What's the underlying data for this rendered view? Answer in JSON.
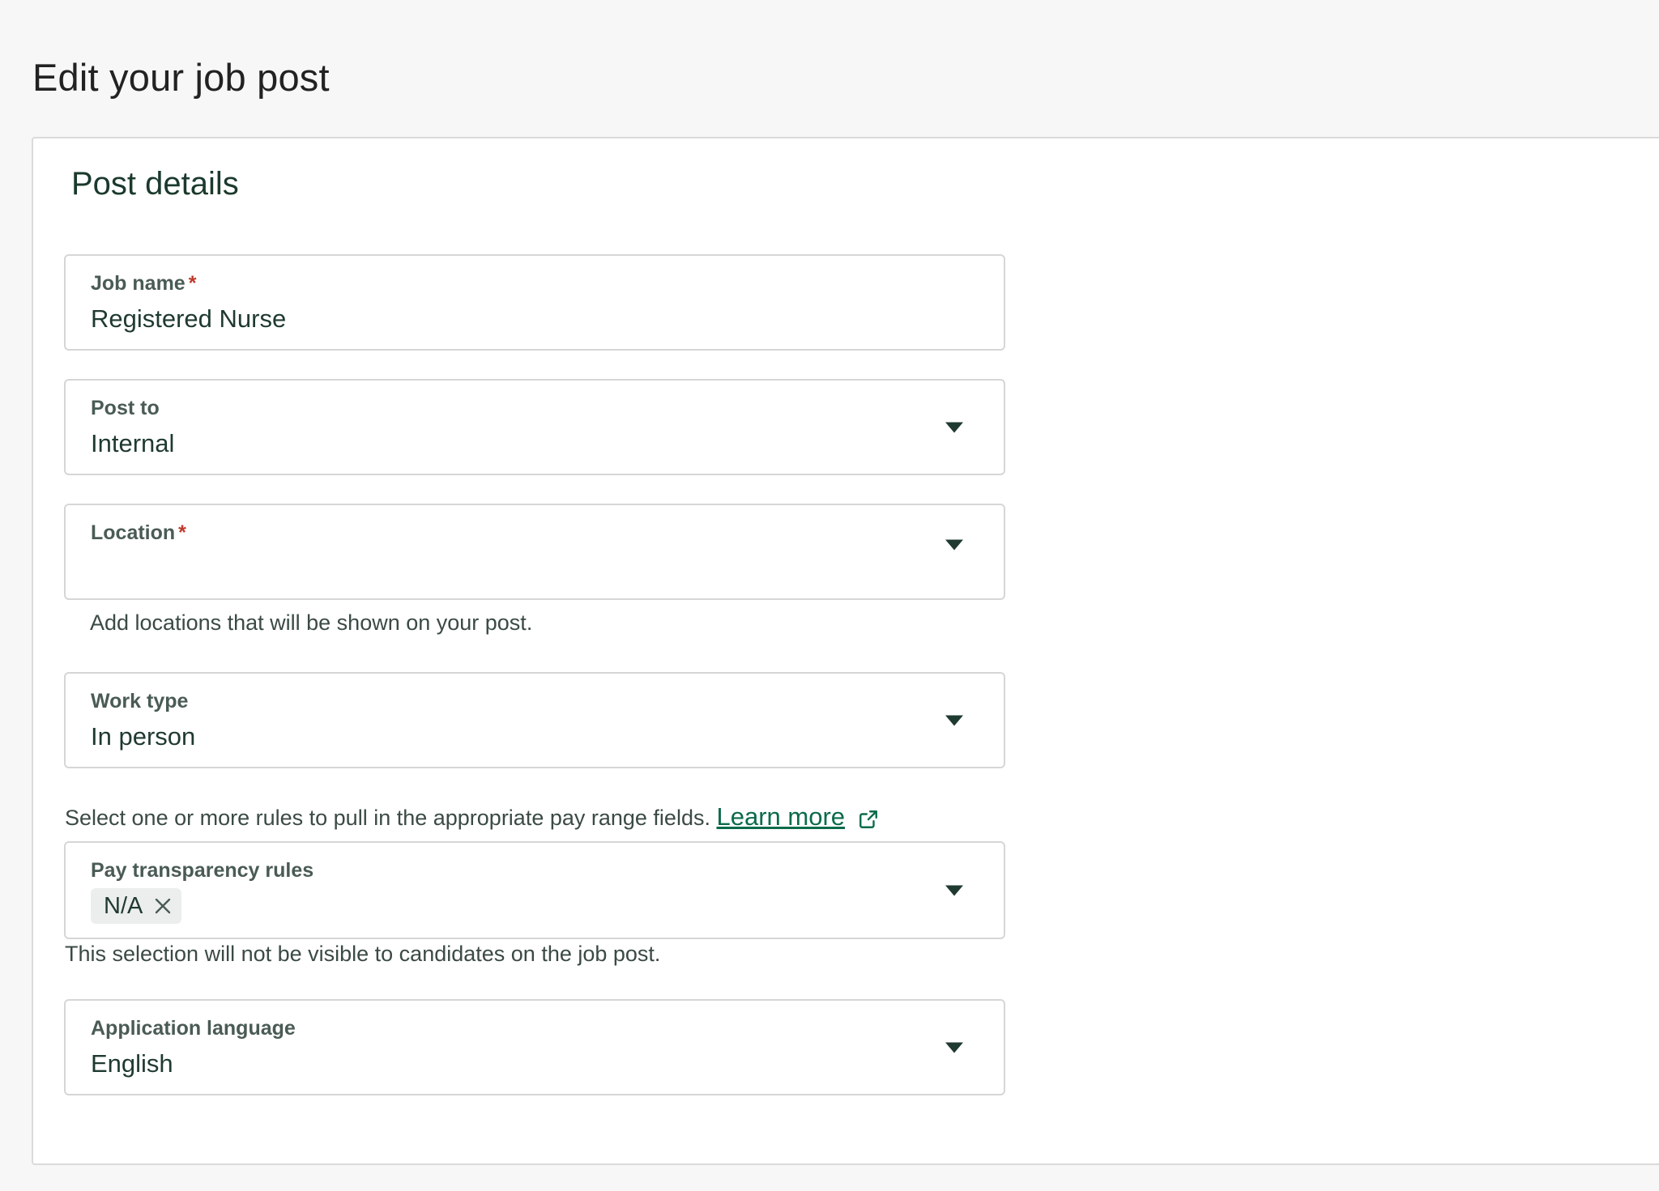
{
  "page": {
    "title": "Edit your job post"
  },
  "card": {
    "title": "Post details"
  },
  "fields": {
    "job_name": {
      "label": "Job name",
      "required_mark": "*",
      "value": "Registered Nurse"
    },
    "post_to": {
      "label": "Post to",
      "value": "Internal"
    },
    "location": {
      "label": "Location",
      "required_mark": "*",
      "value": "",
      "helper": "Add locations that will be shown on your post."
    },
    "work_type": {
      "label": "Work type",
      "value": "In person"
    },
    "pay_transparency": {
      "intro": "Select one or more rules to pull in the appropriate pay range fields.",
      "learn_more": "Learn more",
      "label": "Pay transparency rules",
      "chips": [
        "N/A"
      ],
      "helper": "This selection will not be visible to candidates on the job post."
    },
    "application_language": {
      "label": "Application language",
      "value": "English"
    }
  },
  "icons": {
    "dropdown": "chevron-down-icon",
    "external": "external-link-icon",
    "close": "close-icon"
  },
  "colors": {
    "accent": "#0b6b4a",
    "required": "#c0392b",
    "text_dark": "#1f3a30"
  }
}
